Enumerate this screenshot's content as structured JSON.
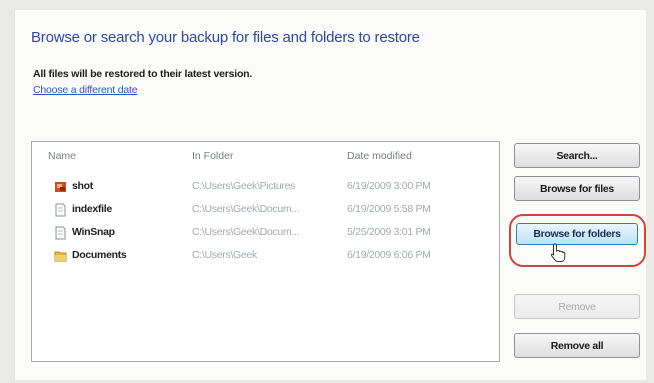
{
  "dialog": {
    "title": "Browse or search your backup for files and folders to restore",
    "notice": "All files will be restored to their latest version.",
    "change_date_link": "Choose a different date"
  },
  "columns": {
    "name": "Name",
    "in_folder": "In Folder",
    "date_modified": "Date modified"
  },
  "rows": [
    {
      "name": "shot",
      "folder": "C:\\Users\\Geek\\Pictures",
      "date": "6/19/2009 3:00 PM",
      "icon": "image-file-icon"
    },
    {
      "name": "indexfile",
      "folder": "C:\\Users\\Geek\\Docum...",
      "date": "6/19/2009 5:58 PM",
      "icon": "document-file-icon"
    },
    {
      "name": "WinSnap",
      "folder": "C:\\Users\\Geek\\Docum...",
      "date": "5/25/2009 3:01 PM",
      "icon": "document-file-icon"
    },
    {
      "name": "Documents",
      "folder": "C:\\Users\\Geek",
      "date": "6/19/2009 6:06 PM",
      "icon": "folder-icon"
    }
  ],
  "buttons": {
    "search": "Search...",
    "browse_files": "Browse for files",
    "browse_folders": "Browse for folders",
    "remove": "Remove",
    "remove_all": "Remove all"
  },
  "colors": {
    "title": "#2f48a6",
    "highlight_ring": "#c9473d",
    "hot_button": "#bfe1f5"
  }
}
